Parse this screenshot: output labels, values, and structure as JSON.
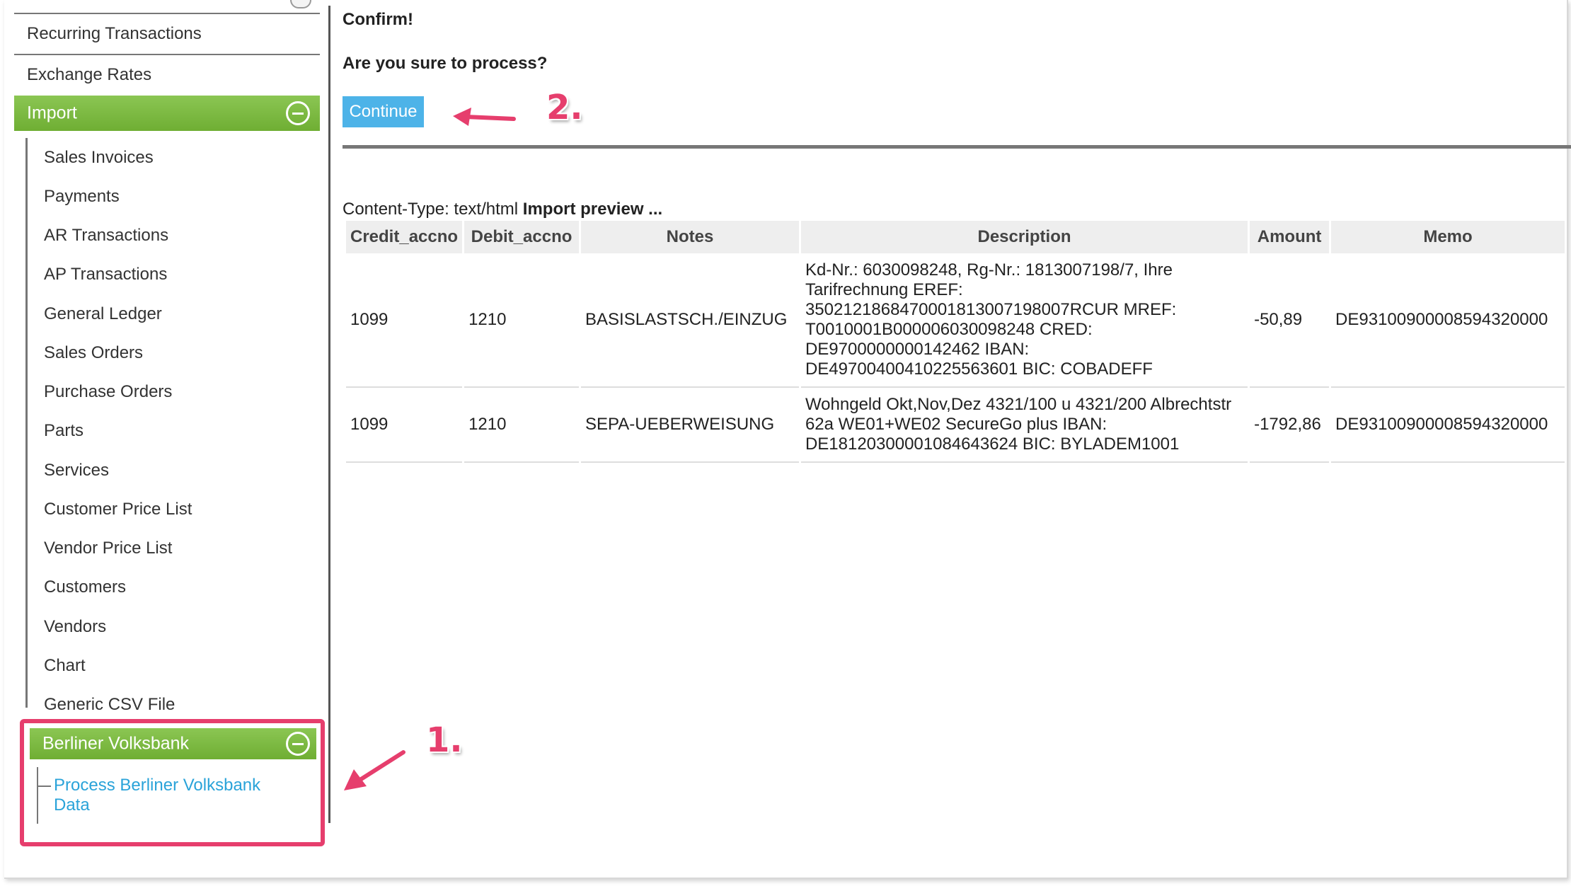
{
  "sidebar": {
    "items_top": [
      {
        "label": "Recurring Transactions"
      },
      {
        "label": "Exchange Rates"
      }
    ],
    "import_group": {
      "label": "Import",
      "items": [
        {
          "label": "Sales Invoices"
        },
        {
          "label": "Payments"
        },
        {
          "label": "AR Transactions"
        },
        {
          "label": "AP Transactions"
        },
        {
          "label": "General Ledger"
        },
        {
          "label": "Sales Orders"
        },
        {
          "label": "Purchase Orders"
        },
        {
          "label": "Parts"
        },
        {
          "label": "Services"
        },
        {
          "label": "Customer Price List"
        },
        {
          "label": "Vendor Price List"
        },
        {
          "label": "Customers"
        },
        {
          "label": "Vendors"
        },
        {
          "label": "Chart"
        },
        {
          "label": "Generic CSV File"
        }
      ]
    },
    "bank_group": {
      "label": "Berliner Volksbank",
      "link": "Process Berliner Volksbank Data"
    }
  },
  "main": {
    "title": "Confirm!",
    "question": "Are you sure to process?",
    "continue_label": "Continue",
    "content_type": "Content-Type: text/html",
    "preview_label": "Import preview ...",
    "table": {
      "headers": [
        "Credit_accno",
        "Debit_accno",
        "Notes",
        "Description",
        "Amount",
        "Memo"
      ],
      "rows": [
        {
          "credit": "1099",
          "debit": "1210",
          "notes": "BASISLASTSCH./EINZUG",
          "description": "Kd-Nr.: 6030098248, Rg-Nr.: 1813007198/7, Ihre Tarifrechnung EREF: 3502121868470001813007198007RCUR MREF: T0010001B000006030098248 CRED: DE9700000000142462 IBAN: DE49700400410225563601 BIC: COBADEFF",
          "amount": "-50,89",
          "memo": "DE93100900008594320000"
        },
        {
          "credit": "1099",
          "debit": "1210",
          "notes": "SEPA-UEBERWEISUNG",
          "description": "Wohngeld Okt,Nov,Dez 4321/100 u 4321/200 Albrechtstr 62a WE01+WE02 SecureGo plus IBAN: DE18120300001084643624 BIC: BYLADEM1001",
          "amount": "-1792,86",
          "memo": "DE93100900008594320000"
        }
      ]
    }
  },
  "annotations": {
    "step1": "1.",
    "step2": "2.",
    "color": "#e63e6d"
  },
  "colors": {
    "menu_green": "#7cba43",
    "button_blue": "#4db3e8",
    "link_blue": "#2aa3d9"
  }
}
